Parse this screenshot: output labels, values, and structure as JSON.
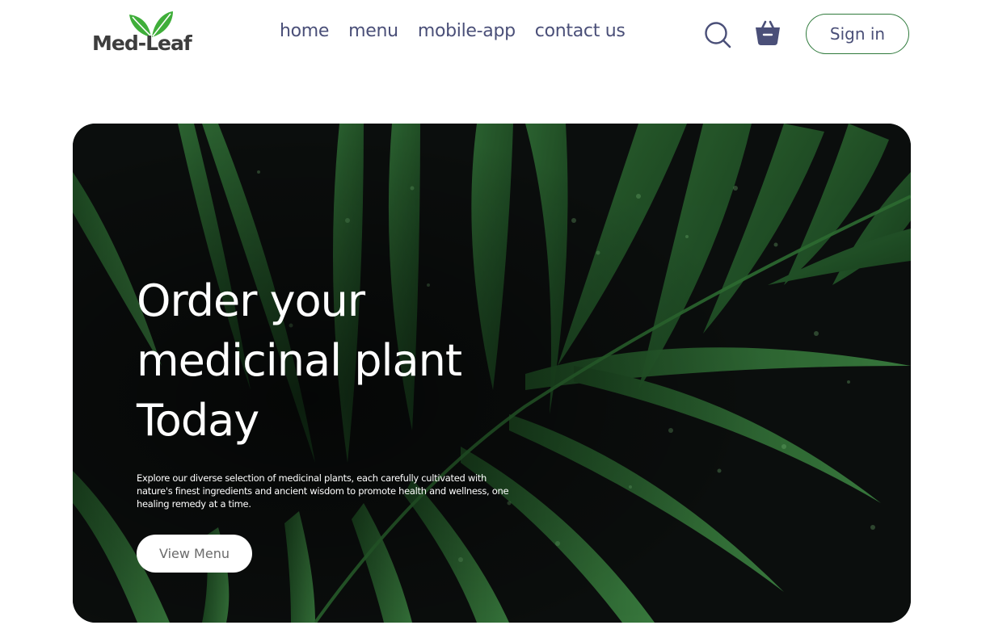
{
  "brand": {
    "name": "Med-Leaf",
    "icon": "leaf-icon"
  },
  "nav": {
    "links": [
      {
        "label": "home"
      },
      {
        "label": "menu"
      },
      {
        "label": "mobile-app"
      },
      {
        "label": "contact us"
      }
    ],
    "search_icon": "search-icon",
    "cart_icon": "basket-icon",
    "signin_label": "Sign in"
  },
  "hero": {
    "title": "Order your medicinal plant Today",
    "description": "Explore our diverse selection of medicinal plants, each carefully cultivated with nature's finest ingredients and ancient wisdom to promote health and wellness, one healing remedy at a time.",
    "cta_label": "View Menu"
  },
  "colors": {
    "nav_text": "#4a4f78",
    "brand_green": "#2f7a3c",
    "leaf_green": "#3fae3a",
    "hero_bg": "#0b0e0d",
    "hero_text": "#ffffff"
  }
}
